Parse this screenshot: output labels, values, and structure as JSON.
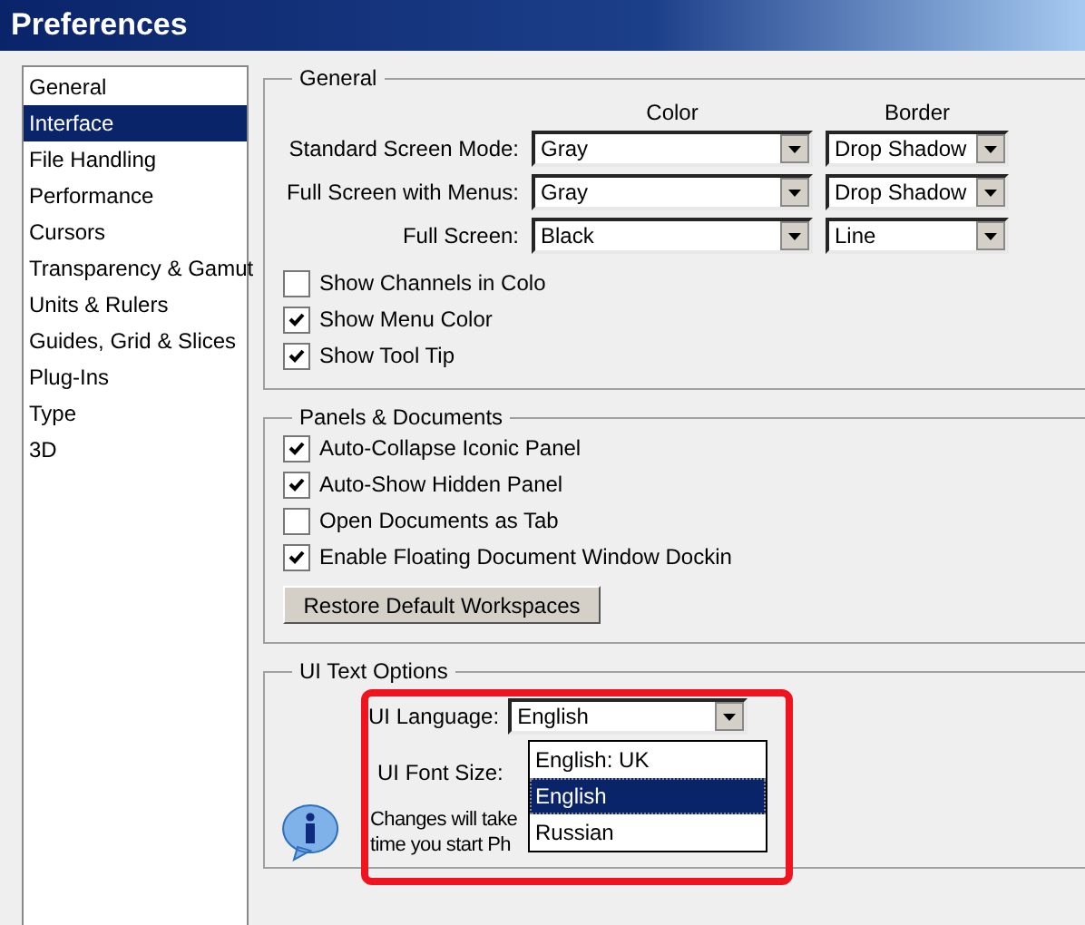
{
  "window": {
    "title": "Preferences"
  },
  "sidebar": {
    "items": [
      {
        "label": "General",
        "selected": false
      },
      {
        "label": "Interface",
        "selected": true
      },
      {
        "label": "File Handling",
        "selected": false
      },
      {
        "label": "Performance",
        "selected": false
      },
      {
        "label": "Cursors",
        "selected": false
      },
      {
        "label": "Transparency & Gamut",
        "selected": false
      },
      {
        "label": "Units & Rulers",
        "selected": false
      },
      {
        "label": "Guides, Grid & Slices",
        "selected": false
      },
      {
        "label": "Plug-Ins",
        "selected": false
      },
      {
        "label": "Type",
        "selected": false
      },
      {
        "label": "3D",
        "selected": false
      }
    ]
  },
  "general": {
    "title": "General",
    "column_headers": [
      "Color",
      "Border"
    ],
    "rows": [
      {
        "label": "Standard Screen Mode:",
        "color_value": "Gray",
        "border_value": "Drop Shadow"
      },
      {
        "label": "Full Screen with Menus:",
        "color_value": "Gray",
        "border_value": "Drop Shadow"
      },
      {
        "label": "Full Screen:",
        "color_value": "Black",
        "border_value": "Line"
      }
    ],
    "checkboxes": [
      {
        "label": "Show Channels in Colo",
        "checked": false
      },
      {
        "label": "Show Menu Color",
        "checked": true
      },
      {
        "label": "Show Tool Tip",
        "checked": true
      }
    ]
  },
  "panels": {
    "title": "Panels & Documents",
    "checkboxes": [
      {
        "label": "Auto-Collapse Iconic Panel",
        "checked": true
      },
      {
        "label": "Auto-Show Hidden Panel",
        "checked": true
      },
      {
        "label": "Open Documents as Tab",
        "checked": false
      },
      {
        "label": "Enable Floating Document Window Dockin",
        "checked": true
      }
    ],
    "button": "Restore Default Workspaces"
  },
  "ui_text": {
    "title": "UI Text Options",
    "language_label": "UI Language:",
    "language_value": "English",
    "font_size_label": "UI Font Size:",
    "note_lines": [
      "Changes will take",
      "time you start Ph"
    ],
    "language_list": {
      "expanded": true,
      "options": [
        {
          "label": "English: UK",
          "selected": false
        },
        {
          "label": "English",
          "selected": true
        },
        {
          "label": "Russian",
          "selected": false
        }
      ]
    }
  },
  "annotation": {
    "shown": true
  }
}
